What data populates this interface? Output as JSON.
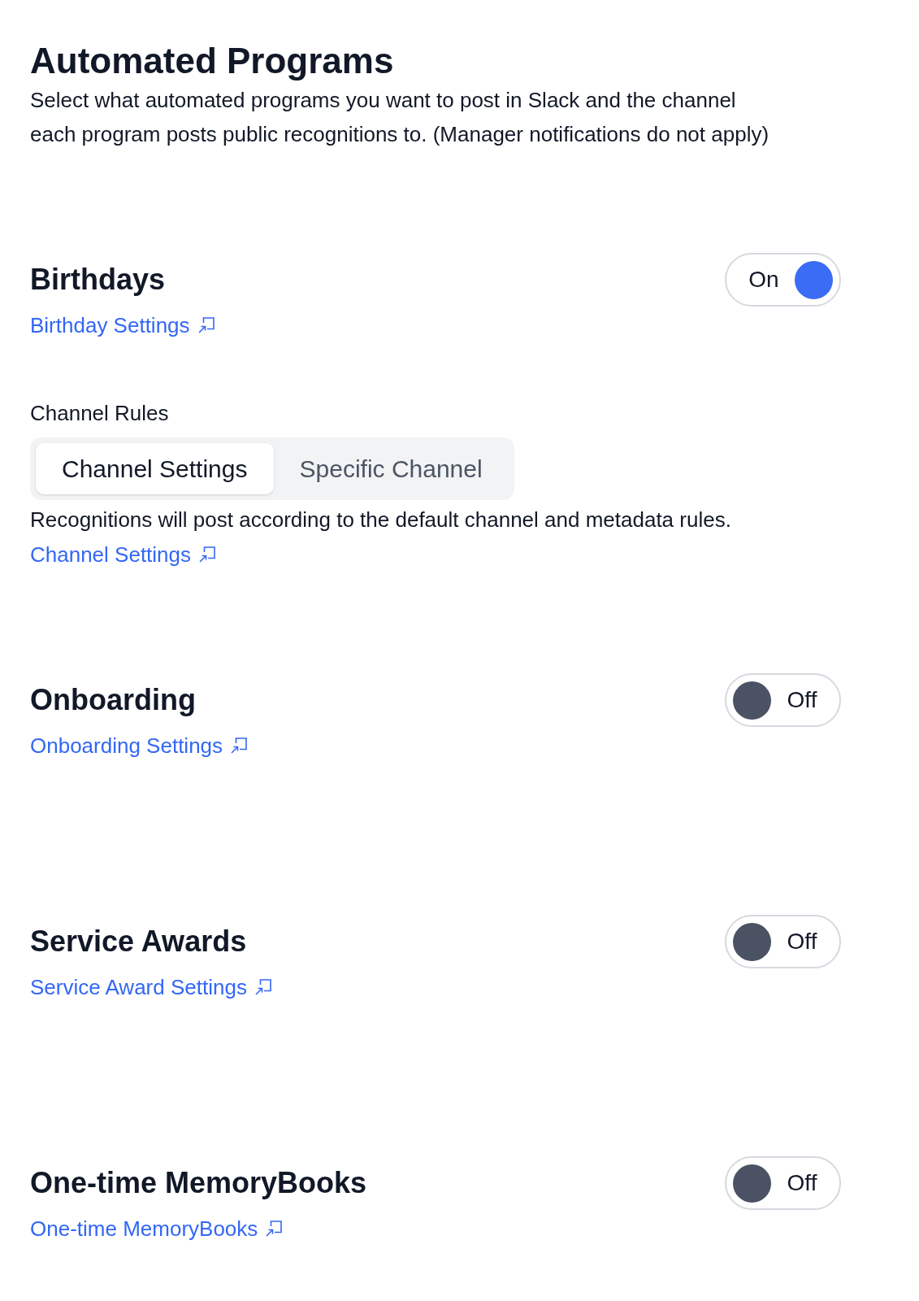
{
  "page": {
    "title": "Automated Programs",
    "description": "Select what automated programs you want to post in Slack and the channel each program posts public recognitions to. (Manager notifications do not apply)"
  },
  "programs": [
    {
      "title": "Birthdays",
      "toggle": {
        "on": true,
        "label": "On"
      },
      "link": "Birthday Settings",
      "channel_rules": {
        "label": "Channel Rules",
        "tabs": [
          {
            "label": "Channel Settings",
            "selected": true
          },
          {
            "label": "Specific Channel",
            "selected": false
          }
        ],
        "description": "Recognitions will post according to the default channel and metadata rules.",
        "link": "Channel Settings"
      }
    },
    {
      "title": "Onboarding",
      "toggle": {
        "on": false,
        "label": "Off"
      },
      "link": "Onboarding Settings"
    },
    {
      "title": "Service Awards",
      "toggle": {
        "on": false,
        "label": "Off"
      },
      "link": "Service Award Settings"
    },
    {
      "title": "One-time MemoryBooks",
      "toggle": {
        "on": false,
        "label": "Off"
      },
      "link": "One-time MemoryBooks"
    }
  ]
}
